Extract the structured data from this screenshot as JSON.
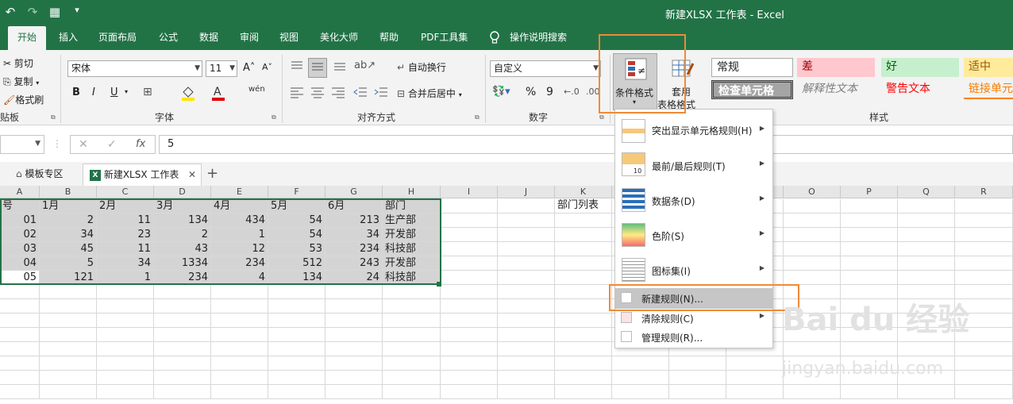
{
  "window": {
    "title": "新建XLSX 工作表 - Excel"
  },
  "qat": {
    "undo": "↶",
    "redo": "↷",
    "save": "▦",
    "more": "▾"
  },
  "tabs": [
    "开始",
    "插入",
    "页面布局",
    "公式",
    "数据",
    "审阅",
    "视图",
    "美化大师",
    "帮助",
    "PDF工具集"
  ],
  "tell_me": "操作说明搜索",
  "clipboard": {
    "cut": "剪切",
    "copy": "复制",
    "format_painter": "格式刷",
    "group": "贴板"
  },
  "font": {
    "name": "宋体",
    "size": "11",
    "grow": "A˄",
    "shrink": "A˅",
    "bold": "B",
    "italic": "I",
    "underline": "U",
    "phonetic": "wén",
    "group": "字体"
  },
  "alignment": {
    "wrap": "自动换行",
    "merge": "合并后居中",
    "group": "对齐方式"
  },
  "number": {
    "format": "自定义",
    "percent": "%",
    "comma": "9",
    "group": "数字"
  },
  "styles": {
    "cond_format": "条件格式",
    "table_format_1": "套用",
    "table_format_2": "表格格式",
    "normal": "常规",
    "bad": "差",
    "good": "好",
    "neutral": "适中",
    "check_cell": "检查单元格",
    "explanatory": "解释性文本",
    "warning": "警告文本",
    "link_cell": "链接单元",
    "group": "样式"
  },
  "formula_bar": {
    "fx": "fx",
    "value": "5"
  },
  "doc_tabs": {
    "template": "模板专区",
    "workbook": "新建XLSX 工作表",
    "add": "+"
  },
  "columns": [
    "A",
    "B",
    "C",
    "D",
    "E",
    "F",
    "G",
    "H",
    "I",
    "J",
    "K",
    "L",
    "M",
    "N",
    "O",
    "P",
    "Q",
    "R"
  ],
  "rows": [
    [
      "号",
      "1月",
      "2月",
      "3月",
      "4月",
      "5月",
      "6月",
      "部门"
    ],
    [
      "01",
      "2",
      "11",
      "134",
      "434",
      "54",
      "213",
      "生产部"
    ],
    [
      "02",
      "34",
      "23",
      "2",
      "1",
      "54",
      "34",
      "开发部"
    ],
    [
      "03",
      "45",
      "11",
      "43",
      "12",
      "53",
      "234",
      "科技部"
    ],
    [
      "04",
      "5",
      "34",
      "1334",
      "234",
      "512",
      "243",
      "开发部"
    ],
    [
      "05",
      "121",
      "1",
      "234",
      "4",
      "134",
      "24",
      "科技部"
    ]
  ],
  "k1": "部门列表",
  "menu": [
    {
      "label": "突出显示单元格规则(H)",
      "sub": true
    },
    {
      "label": "最前/最后规则(T)",
      "sub": true
    },
    {
      "label": "数据条(D)",
      "sub": true
    },
    {
      "label": "色阶(S)",
      "sub": true
    },
    {
      "label": "图标集(I)",
      "sub": true
    },
    {
      "label": "新建规则(N)...",
      "sub": false
    },
    {
      "label": "清除规则(C)",
      "sub": true
    },
    {
      "label": "管理规则(R)...",
      "sub": false
    }
  ],
  "watermark": {
    "main": "Bai du 经验",
    "url": "jingyan.baidu.com"
  }
}
